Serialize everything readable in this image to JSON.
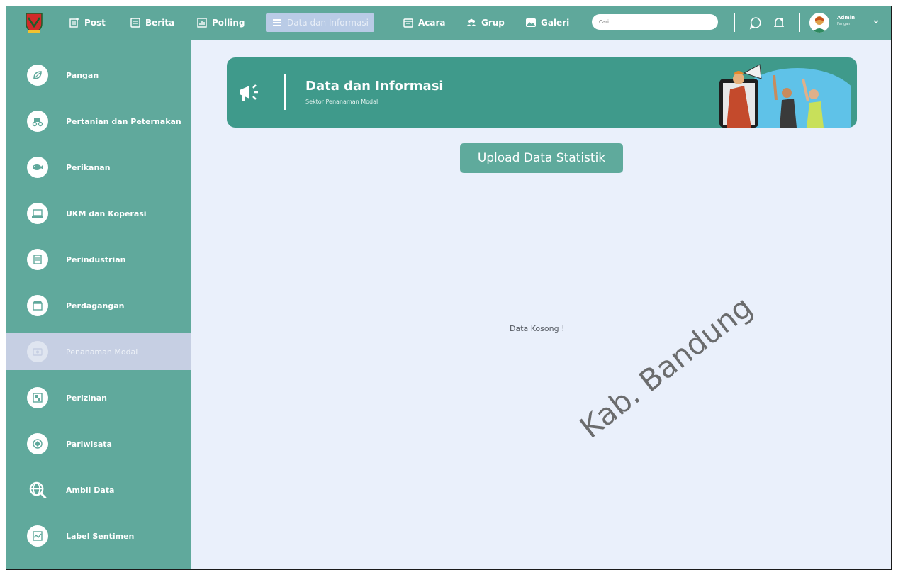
{
  "nav": {
    "items": [
      {
        "label": "Post"
      },
      {
        "label": "Berita"
      },
      {
        "label": "Polling"
      },
      {
        "label": "Data dan Informasi"
      },
      {
        "label": "Acara"
      },
      {
        "label": "Grup"
      },
      {
        "label": "Galeri"
      }
    ],
    "active_index": 3,
    "search_placeholder": "Cari...",
    "user": {
      "name": "Admin",
      "role": "Pangan"
    }
  },
  "sidebar": {
    "items": [
      {
        "label": "Pangan",
        "icon": "leaf-icon"
      },
      {
        "label": "Pertanian dan Peternakan",
        "icon": "farm-icon"
      },
      {
        "label": "Perikanan",
        "icon": "fish-icon"
      },
      {
        "label": "UKM dan Koperasi",
        "icon": "laptop-icon"
      },
      {
        "label": "Perindustrian",
        "icon": "factory-icon"
      },
      {
        "label": "Perdagangan",
        "icon": "store-icon"
      },
      {
        "label": "Penanaman Modal",
        "icon": "investment-icon"
      },
      {
        "label": "Perizinan",
        "icon": "license-icon"
      },
      {
        "label": "Pariwisata",
        "icon": "tourism-icon"
      },
      {
        "label": "Ambil Data",
        "icon": "globe-search-icon"
      },
      {
        "label": "Label Sentimen",
        "icon": "sentiment-chart-icon"
      }
    ],
    "active_index": 6
  },
  "banner": {
    "title": "Data dan Informasi",
    "subtitle": "Sektor Penanaman Modal"
  },
  "main": {
    "upload_button": "Upload Data Statistik",
    "empty_message": "Data Kosong !",
    "watermark": "Kab. Bandung"
  },
  "colors": {
    "primary": "#5fa89b",
    "banner": "#3f9a8b",
    "background": "#eaf0fb",
    "active_sidebar": "#c6cfe3"
  }
}
